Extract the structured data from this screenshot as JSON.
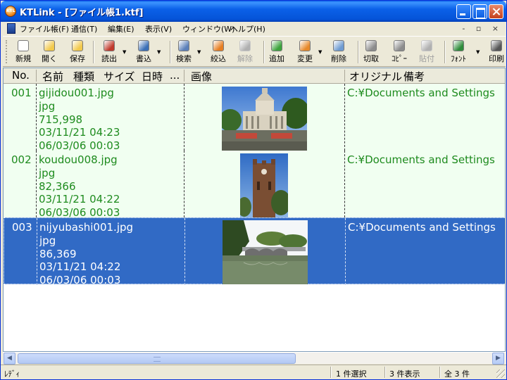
{
  "window": {
    "title": "KTLink - [ファイル帳1.ktf]",
    "app_icon_letters": "KTL"
  },
  "menu": {
    "items": [
      "ファイル帳(F)",
      "通信(T)",
      "編集(E)",
      "表示(V)",
      "ウィンドウ(W)",
      "ヘルプ(H)"
    ],
    "mdi_controls": "- ▫ ×"
  },
  "toolbar": {
    "buttons": [
      {
        "label": "新規",
        "icon": "new-file-icon",
        "color": "#FFFFFF",
        "enabled": true
      },
      {
        "label": "開く",
        "icon": "open-folder-icon",
        "color": "#F2C94C",
        "enabled": true
      },
      {
        "label": "保存",
        "icon": "save-folder-icon",
        "color": "#F2C94C",
        "enabled": true
      },
      {
        "label": "読出",
        "icon": "read-icon",
        "color": "#C0392B",
        "enabled": true
      },
      {
        "label": "書込",
        "icon": "write-icon",
        "color": "#3B6FB6",
        "enabled": true
      },
      {
        "label": "検索",
        "icon": "search-icon",
        "color": "#5B7FB9",
        "enabled": true
      },
      {
        "label": "絞込",
        "icon": "filter-icon",
        "color": "#E67E22",
        "enabled": true
      },
      {
        "label": "解除",
        "icon": "unfilter-icon",
        "color": "#B0B0B0",
        "enabled": false
      },
      {
        "label": "追加",
        "icon": "add-icon",
        "color": "#3CA33C",
        "enabled": true
      },
      {
        "label": "変更",
        "icon": "modify-icon",
        "color": "#E6892B",
        "enabled": true
      },
      {
        "label": "削除",
        "icon": "delete-icon",
        "color": "#6E9BD1",
        "enabled": true
      },
      {
        "label": "切取",
        "icon": "cut-icon",
        "color": "#8C8C8C",
        "enabled": true
      },
      {
        "label": "ｺﾋﾟｰ",
        "icon": "copy-icon",
        "color": "#8C8C8C",
        "enabled": true
      },
      {
        "label": "貼付",
        "icon": "paste-icon",
        "color": "#B0B0B0",
        "enabled": false
      },
      {
        "label": "ﾌｫﾝﾄ",
        "icon": "font-icon",
        "color": "#2E8B3A",
        "enabled": true
      },
      {
        "label": "印刷",
        "icon": "print-icon",
        "color": "#555555",
        "enabled": true
      }
    ]
  },
  "list": {
    "headers": [
      "No.",
      "名前",
      "種類",
      "サイズ",
      "日時",
      "...",
      "画像",
      "オリジナル",
      "備考"
    ],
    "rows": [
      {
        "no": "001",
        "name": "gijidou001.jpg",
        "type": "jpg",
        "size": "715,998",
        "date1": "03/11/21 04:23",
        "date2": "06/03/06 00:03",
        "original": "C:¥Documents and Settings",
        "selected": false
      },
      {
        "no": "002",
        "name": "koudou008.jpg",
        "type": "jpg",
        "size": "82,366",
        "date1": "03/11/21 04:22",
        "date2": "06/03/06 00:03",
        "original": "C:¥Documents and Settings",
        "selected": false
      },
      {
        "no": "003",
        "name": "nijyubashi001.jpg",
        "type": "jpg",
        "size": "86,369",
        "date1": "03/11/21 04:22",
        "date2": "06/03/06 00:03",
        "original": "C:¥Documents and Settings",
        "selected": true
      }
    ]
  },
  "statusbar": {
    "ready": "ﾚﾃﾞｨ",
    "selected": "1 件選択",
    "shown": "3 件表示",
    "total": "全 3 件"
  },
  "colors": {
    "row_text": "#1E8B1E",
    "row_bg": "#F1FFF1",
    "selection_bg": "#316AC5"
  }
}
